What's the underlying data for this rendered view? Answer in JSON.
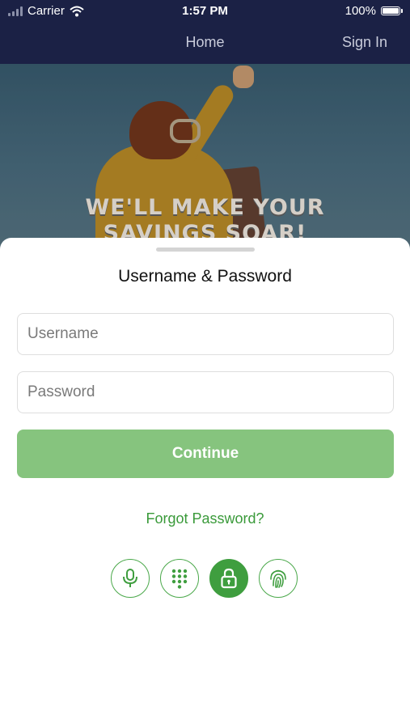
{
  "status_bar": {
    "carrier": "Carrier",
    "time": "1:57 PM",
    "battery": "100%"
  },
  "nav": {
    "title": "Home",
    "sign_in": "Sign In"
  },
  "hero": {
    "headline_line1": "WE'LL MAKE YOUR",
    "headline_line2": "SAVINGS SOAR!"
  },
  "login_sheet": {
    "title": "Username & Password",
    "username_placeholder": "Username",
    "password_placeholder": "Password",
    "continue_label": "Continue",
    "forgot_label": "Forgot Password?",
    "auth_methods": [
      {
        "icon": "microphone-icon",
        "active": false
      },
      {
        "icon": "keypad-icon",
        "active": false
      },
      {
        "icon": "lock-icon",
        "active": true
      },
      {
        "icon": "fingerprint-icon",
        "active": false
      }
    ]
  },
  "colors": {
    "nav_bg": "#1b2145",
    "accent_green": "#3f9e3f",
    "button_green": "#86c47e"
  }
}
